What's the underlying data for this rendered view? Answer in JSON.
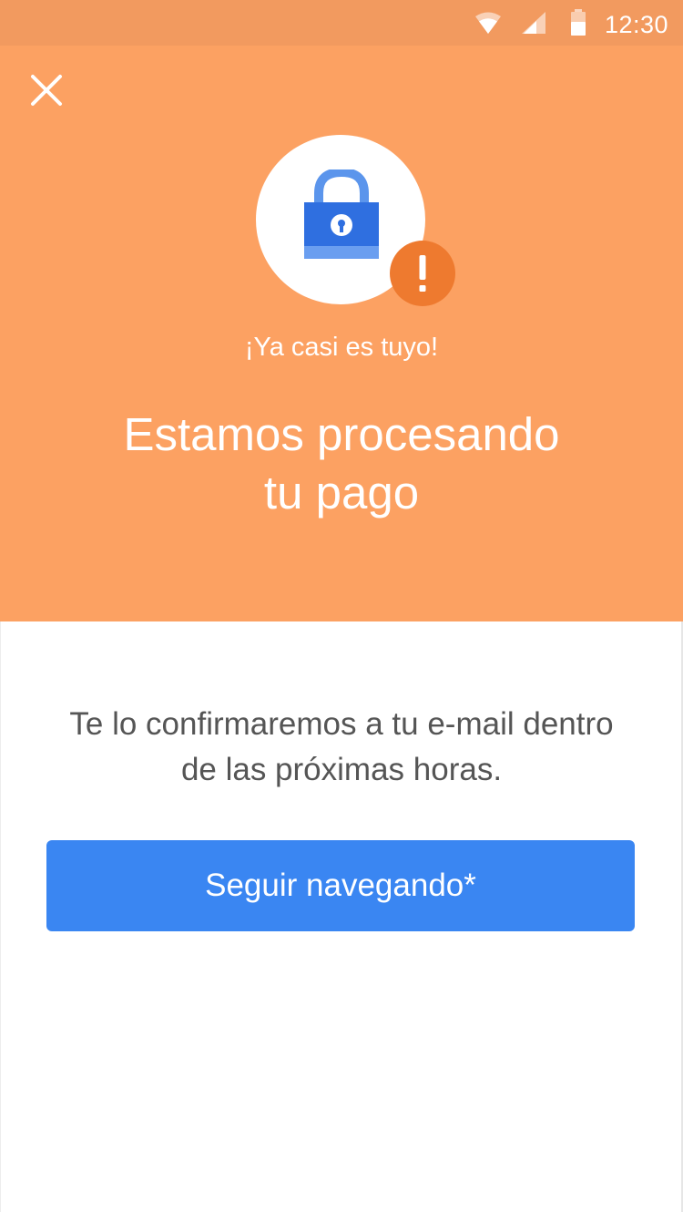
{
  "status_bar": {
    "time": "12:30",
    "icons": [
      "wifi-icon",
      "signal-icon",
      "battery-icon"
    ]
  },
  "header": {
    "close_icon": "close-icon",
    "illustration_icon": "lock-icon",
    "badge_icon": "alert-icon",
    "badge_text": "!",
    "subtitle": "¡Ya casi es tuyo!",
    "title_line1": "Estamos procesando",
    "title_line2": "tu pago"
  },
  "body": {
    "message_line1": "Te lo confirmaremos a tu e-mail dentro",
    "message_line2": "de las próximas horas.",
    "primary_button_label": "Seguir navegando*"
  },
  "colors": {
    "status_bar": "#f29a5f",
    "header": "#fca162",
    "badge": "#ee7a2f",
    "lock": "#2f6fe0",
    "button": "#3a86f2"
  }
}
